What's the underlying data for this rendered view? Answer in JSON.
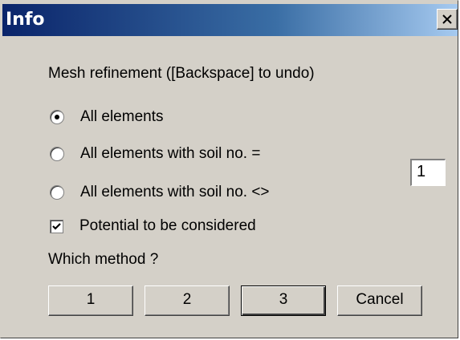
{
  "window": {
    "title": "Info",
    "close_icon": "close-icon"
  },
  "dialog": {
    "heading": "Mesh refinement ([Backspace] to undo)",
    "options": [
      {
        "label": "All elements",
        "checked": true
      },
      {
        "label": "All elements with soil no. =",
        "checked": false
      },
      {
        "label": "All elements with soil no. <>",
        "checked": false
      }
    ],
    "soil_number": "1",
    "potential": {
      "label": "Potential to be considered",
      "checked": true
    },
    "method_label": "Which method ?",
    "buttons": {
      "b1": "1",
      "b2": "2",
      "b3": "3",
      "cancel": "Cancel"
    }
  },
  "colors": {
    "title_gradient_start": "#0a246a",
    "title_gradient_end": "#a6caf0",
    "face": "#d4d0c8"
  }
}
